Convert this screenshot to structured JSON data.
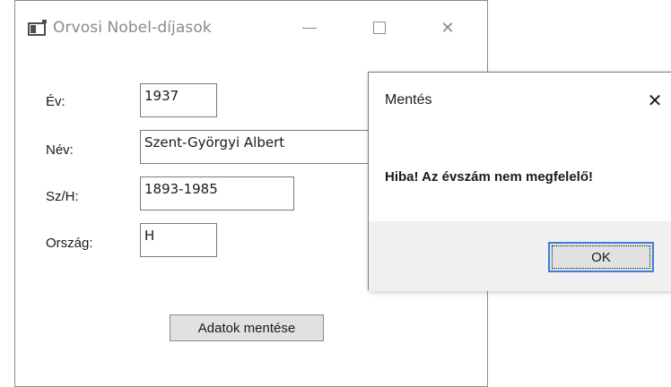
{
  "main_window": {
    "title": "Orvosi Nobel-díjasok",
    "controls": {
      "minimize_icon": "minimize-icon",
      "maximize_icon": "maximize-icon",
      "close_icon": "close-icon",
      "close_glyph": "✕"
    },
    "fields": {
      "year": {
        "label": "Év:",
        "value": "1937"
      },
      "name": {
        "label": "Név:",
        "value": "Szent-Györgyi Albert"
      },
      "birth_death": {
        "label": "Sz/H:",
        "value": "1893-1985"
      },
      "country": {
        "label": "Ország:",
        "value": "H"
      }
    },
    "save_button": "Adatok mentése"
  },
  "dialog": {
    "title": "Mentés",
    "close_glyph": "✕",
    "message": "Hiba! Az évszám nem megfelelő!",
    "ok_button": "OK"
  },
  "colors": {
    "dialog_footer": "#f0f0f0",
    "button_face": "#e1e1e1",
    "focus_border": "#3c7fd9"
  }
}
